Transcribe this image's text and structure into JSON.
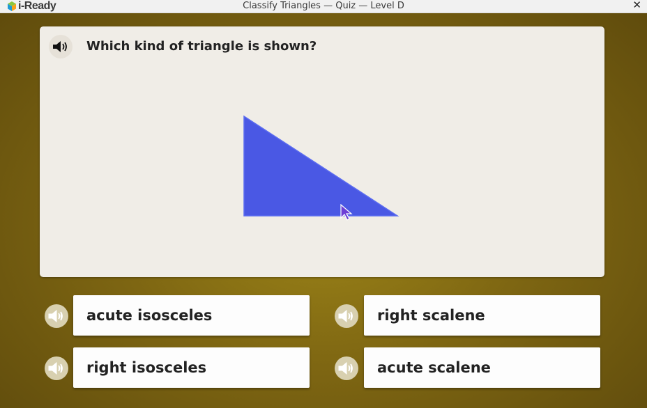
{
  "window": {
    "app_name": "i-Ready",
    "title": "Classify Triangles — Quiz — Level D",
    "close_glyph": "✕"
  },
  "question": {
    "text": "Which kind of triangle is shown?",
    "speaker_icon": "speaker-icon",
    "figure": {
      "shape": "right triangle",
      "color": "#4a58e4"
    }
  },
  "answers": [
    {
      "label": "acute isosceles"
    },
    {
      "label": "right scalene"
    },
    {
      "label": "right isosceles"
    },
    {
      "label": "acute scalene"
    }
  ],
  "colors": {
    "background": "#7e6612",
    "card": "#f0ede7",
    "triangle": "#4a58e4",
    "cursor": "#6d3fd6"
  }
}
